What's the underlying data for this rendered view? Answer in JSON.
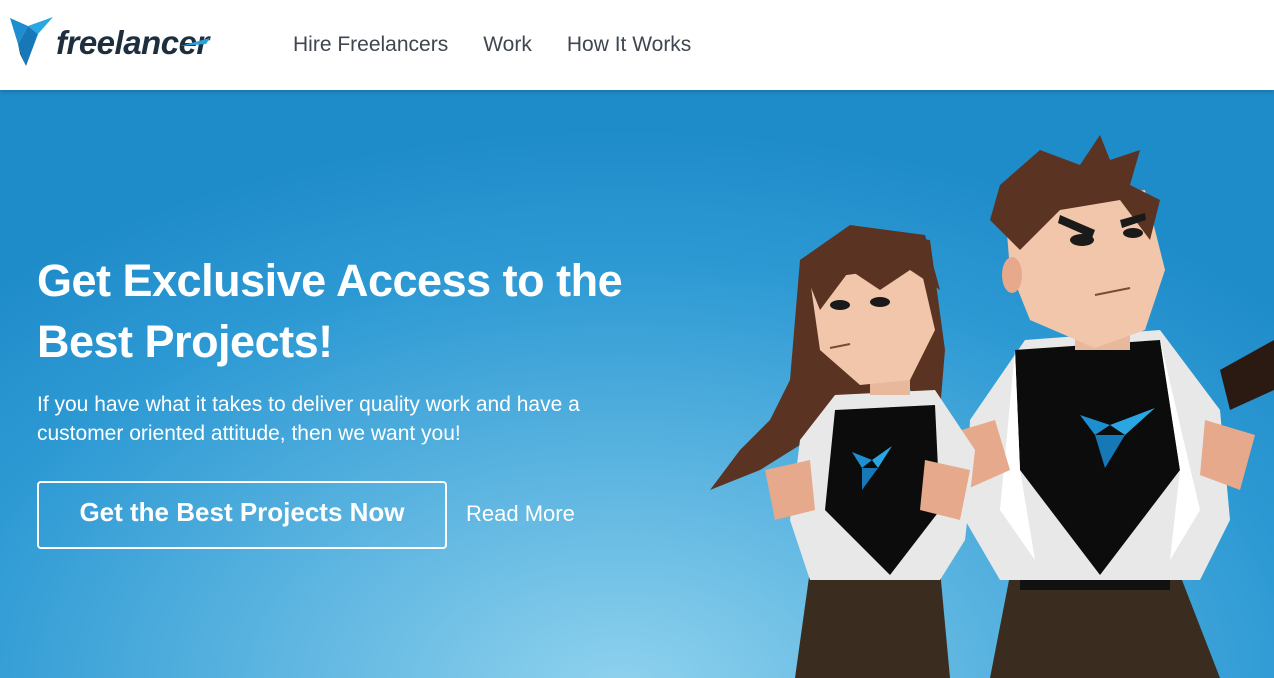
{
  "header": {
    "logo_text": "freelancer",
    "nav": [
      "Hire Freelancers",
      "Work",
      "How It Works"
    ]
  },
  "hero": {
    "headline": "Get Exclusive Access to the Best Projects!",
    "subtext": "If you have what it takes to deliver quality work and have a customer oriented attitude, then we want you!",
    "cta_label": "Get the Best Projects Now",
    "read_more": "Read More"
  },
  "colors": {
    "brand_blue": "#29a3dc",
    "hero_bg": "#2e9ad4",
    "nav_text": "#3f4650"
  },
  "icons": [
    "freelancer-bird-logo-icon"
  ],
  "illustration": "two-superhero-freelancers"
}
